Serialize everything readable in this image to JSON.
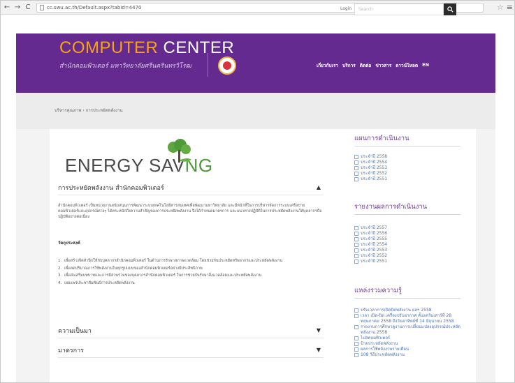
{
  "browser": {
    "url": "cc.swu.ac.th/Default.aspx?tabid=4470"
  },
  "topbar": {
    "login_label": "Login",
    "search_placeholder": "Search"
  },
  "header": {
    "title_part1": "COMPUTER",
    "title_part2": "CENTER",
    "subtitle": "สำนักคอมพิวเตอร์ มหาวิทยาลัยศรีนครินทรวิโรฒ",
    "nav": [
      "เกี่ยวกับเรา",
      "บริการ",
      "ติดต่อ",
      "ข่าวสาร",
      "ดาวน์โหลด",
      "EN"
    ]
  },
  "breadcrumb": {
    "items": [
      "บริหารคุณภาพ",
      "การประหยัดพลังงาน"
    ],
    "separator": "›"
  },
  "banner": {
    "text_part1": "ENERGY SAV",
    "text_part2": "NG"
  },
  "main": {
    "section1_title": "การประหยัดพลังงาน สำนักคอมพิวเตอร์",
    "intro": "สำนักคอมพิวเตอร์ เป็นหน่วยงานสนับสนุนการพัฒนาระบบเทคโนโลยีสารสนเทศเพื่อพัฒนามหาวิทยาลัย และมีหน้าที่ในการบริหารจัดการระบบเครือข่ายคอมพิวเตอร์และอุปกรณ์ต่างๆ ได้ตระหนักถึงความสำคัญของการประหยัดพลังงาน จึงได้กำหนดมาตรการ และแนวทางปฏิบัติในการประหยัดพลังงานให้บุคลากรถือปฏิบัติอย่างต่อเนื่อง",
    "objectives_label": "วัตถุประสงค์",
    "objectives": [
      "เพื่อสร้างจิตสำนึกให้กับบุคลากรสำนักคอมพิวเตอร์ ในด้านการรักษาสภาพแวดล้อม โดยช่วยกันประหยัดทรัพยากรและประหยัดพลังงาน",
      "เพื่อลดปริมาณการใช้พลังงานในทุกรูปแบบของสำนักคอมพิวเตอร์อย่างมีประสิทธิภาพ",
      "เพื่อส่งเสริมบทบาทและการมีส่วนร่วมของบุคลากรสำนักคอมพิวเตอร์ ในการช่วยกันรักษาสิ่งแวดล้อมและประหยัดพลังงาน",
      "เผยแพร่ประชาสัมพันธ์การประหยัดพลังงาน"
    ],
    "section2_title": "ความเป็นมา",
    "section3_title": "มาตรการ"
  },
  "sidebar": {
    "plans_title": "แผนการดำเนินงาน",
    "plans": [
      "ประจำปี 2558",
      "ประจำปี 2554",
      "ประจำปี 2553",
      "ประจำปี 2552",
      "ประจำปี 2551"
    ],
    "reports_title": "รายงานผลการดำเนินงาน",
    "reports": [
      "ประจำปี 2557",
      "ประจำปี 2556",
      "ประจำปี 2555",
      "ประจำปี 2554",
      "ประจำปี 2553",
      "ประจำปี 2552",
      "ประจำปี 2551"
    ],
    "knowledge_title": "แหล่งรวมความรู้",
    "knowledge": [
      "ปรับเวลาการเปิดปิดพลังงาน ผลฯ 2558",
      "เวลา เปิด-ปิด เครื่องปรับอากาศ ตั้งแต่วันเสาร์ที่ 28 พฤษภาคม 2558 ถึงวันอาทิตย์ที่ 14 มิถุนายน 2558",
      "รายงานการศึกษาดูงานการเปลี่ยนแปลงอุปกรณ์ประหยัดพลังงาน 2558",
      "ไปสคอมพิวเตอร์",
      "ป้ายประหยัดพลังงาน",
      "ผลการใช้พลังงานรายเดือน",
      "108 วิธีประหยัดพลังงาน"
    ]
  },
  "colors": {
    "header_purple": "#652a8f",
    "brand_orange": "#f7a21a",
    "leaf_green": "#4f9a38",
    "link_blue": "#4a73b6",
    "sidebar_title": "#6d3f96"
  }
}
